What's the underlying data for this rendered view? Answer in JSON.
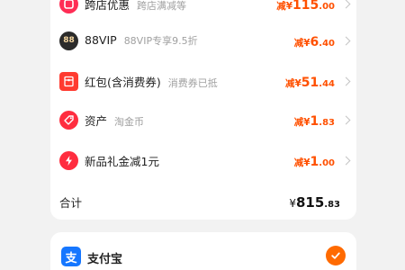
{
  "rows": [
    {
      "label": "跨店优惠",
      "sub": "跨店满减等",
      "amount_prefix": "减¥",
      "amount_int": "115",
      "amount_dec": ".00",
      "icon": "cross-store-icon"
    },
    {
      "label": "88VIP",
      "sub": "88VIP专享9.5折",
      "amount_prefix": "减¥",
      "amount_int": "6",
      "amount_dec": ".40",
      "icon": "vip-88-icon",
      "icon_text": "88"
    },
    {
      "label": "红包(含消费券)",
      "sub": "消费券已抵",
      "amount_prefix": "减¥",
      "amount_int": "51",
      "amount_dec": ".44",
      "icon": "red-packet-icon"
    },
    {
      "label": "资产",
      "sub": "淘金币",
      "amount_prefix": "减¥",
      "amount_int": "1",
      "amount_dec": ".83",
      "icon": "asset-tag-icon"
    },
    {
      "label": "新品礼金减1元",
      "sub": "",
      "amount_prefix": "减¥",
      "amount_int": "1",
      "amount_dec": ".00",
      "icon": "lightning-icon"
    }
  ],
  "total": {
    "label": "合计",
    "currency": "¥",
    "int": "815",
    "dec": ".83"
  },
  "payment": {
    "label": "支付宝",
    "icon": "alipay-icon",
    "icon_text": "支",
    "selected": true
  },
  "colors": {
    "accent": "#ff5000",
    "brand_red": "#ff3b30",
    "alipay_blue": "#1677ff",
    "check_orange": "#ff6a00"
  }
}
